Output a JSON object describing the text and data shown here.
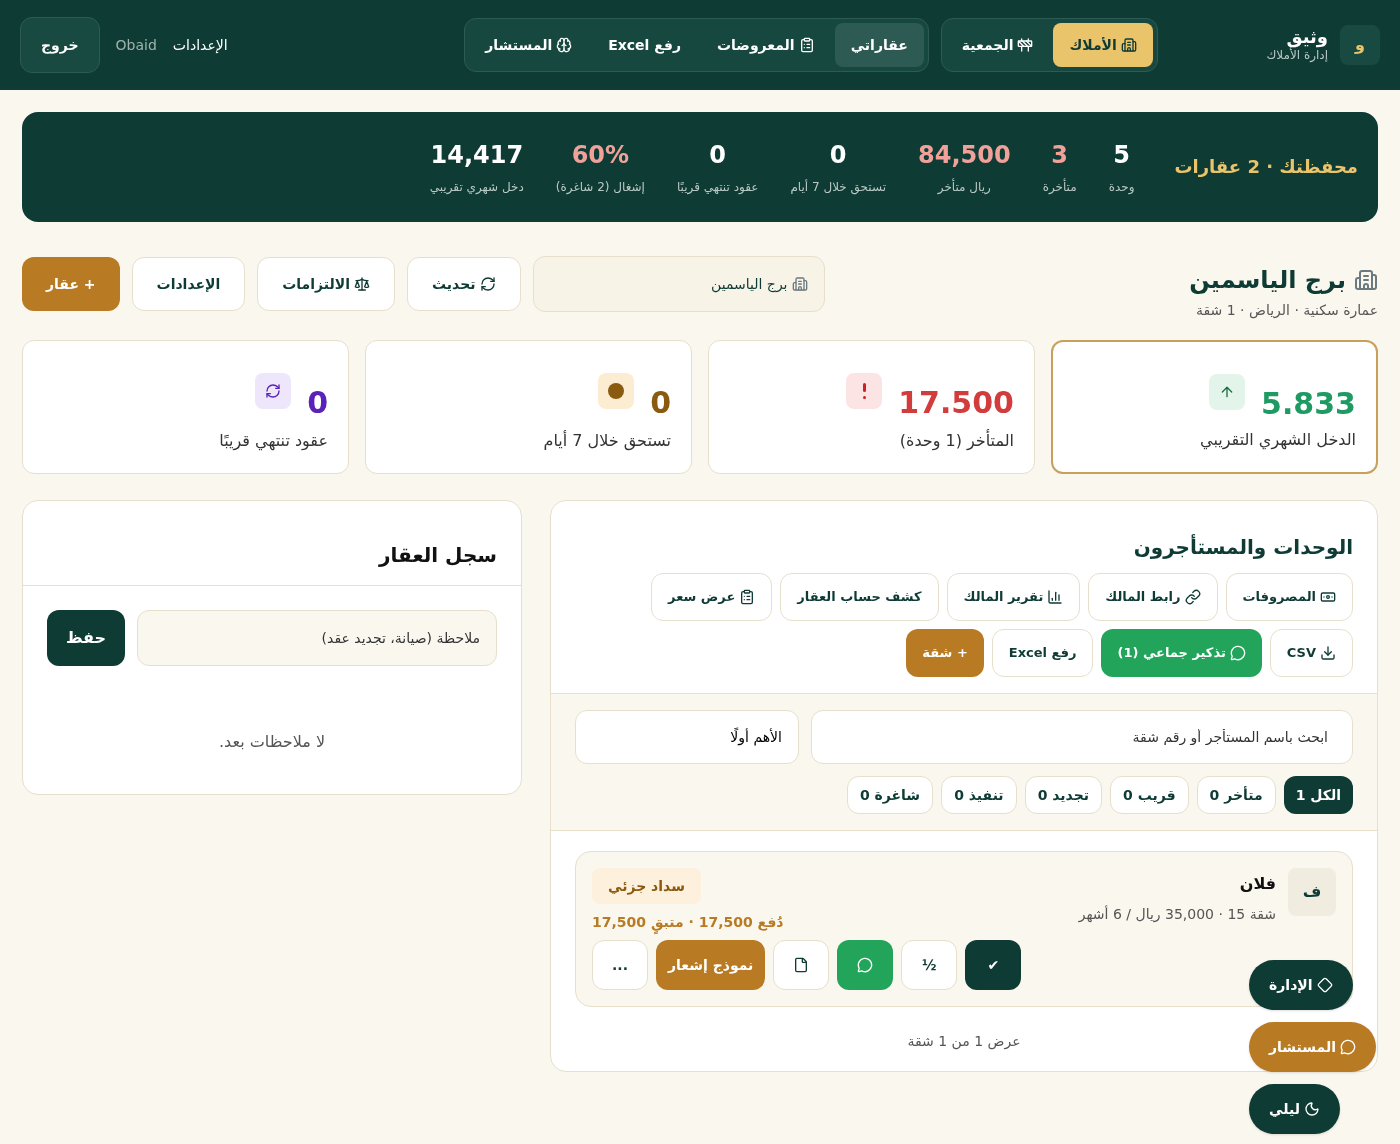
{
  "header": {
    "logo": "و",
    "brand": "وثيق",
    "subtitle": "إدارة الأملاك",
    "modes": [
      {
        "label": "الأملاك",
        "selected": true
      },
      {
        "label": "الجمعية",
        "selected": false
      }
    ],
    "nav": [
      {
        "label": "عقاراتي",
        "selected": true
      },
      {
        "label": "المعروضات",
        "selected": false
      },
      {
        "label": "رفع Excel",
        "selected": false
      },
      {
        "label": "المستشار",
        "selected": false
      }
    ],
    "settings": "الإعدادات",
    "user": "Obaid",
    "logout": "خروج"
  },
  "summary": {
    "title": "محفظتك · 2 عقارات",
    "stats": [
      {
        "value": "5",
        "label": "وحدة",
        "kind": "plain"
      },
      {
        "value": "3",
        "label": "متأخرة",
        "kind": "alert"
      },
      {
        "value": "84,500",
        "label": "ريال متأخر",
        "kind": "alert"
      },
      {
        "value": "0",
        "label": "تستحق خلال 7 أيام",
        "kind": "plain"
      },
      {
        "value": "0",
        "label": "عقود تنتهي قريبًا",
        "kind": "plain"
      },
      {
        "value": "60%",
        "label": "إشغال (2 شاغرة)",
        "kind": "alert"
      },
      {
        "value": "14,417",
        "label": "دخل شهري تقريبي",
        "kind": "plain"
      }
    ]
  },
  "property": {
    "title": "برج الياسمين",
    "subtitle": "عمارة سكنية · الرياض · 1 شقة",
    "selector": "برج الياسمين",
    "actions": [
      {
        "label": "تحديث",
        "kind": "outline"
      },
      {
        "label": "الالتزامات",
        "kind": "outline"
      },
      {
        "label": "الإعدادات",
        "kind": "outline"
      },
      {
        "label": "+ عقار",
        "kind": "primary"
      }
    ]
  },
  "kpis": [
    {
      "label": "الدخل الشهري التقريبي",
      "value": "5.833",
      "kind": "income",
      "selected": true
    },
    {
      "label": "المتأخر (1 وحدة)",
      "value": "17.500",
      "kind": "overdue",
      "selected": false
    },
    {
      "label": "تستحق خلال 7 أيام",
      "value": "0",
      "kind": "due",
      "selected": false
    },
    {
      "label": "عقود تنتهي قريبًا",
      "value": "0",
      "kind": "expiring",
      "selected": false
    }
  ],
  "units": {
    "title": "الوحدات والمستأجرون",
    "tools": [
      {
        "label": "المصروفات",
        "kind": "outline"
      },
      {
        "label": "رابط المالك",
        "kind": "outline"
      },
      {
        "label": "تقرير المالك",
        "kind": "outline"
      },
      {
        "label": "كشف حساب العقار",
        "kind": "outline"
      },
      {
        "label": "عرض سعر",
        "kind": "outline"
      },
      {
        "label": "CSV",
        "kind": "outline"
      },
      {
        "label": "تذكير جماعي (1)",
        "kind": "green"
      },
      {
        "label": "رفع Excel",
        "kind": "outline"
      },
      {
        "label": "+ شقة",
        "kind": "primary"
      }
    ],
    "search": {
      "placeholder": "ابحث باسم المستأجر أو رقم شقة"
    },
    "sort": "الأهم أولًا",
    "filters": [
      {
        "label": "الكل 1",
        "selected": true
      },
      {
        "label": "متأخر 0",
        "selected": false
      },
      {
        "label": "قريب 0",
        "selected": false
      },
      {
        "label": "تجديد 0",
        "selected": false
      },
      {
        "label": "تنفيذ 0",
        "selected": false
      },
      {
        "label": "شاغرة 0",
        "selected": false
      }
    ],
    "unit": {
      "initial": "ف",
      "name": "فلان",
      "details": "شقة 15 · 35,000 ريال / 6 أشهر",
      "status": "سداد جزئي",
      "payment": "دُفع 17,500 · متبقٍ 17,500",
      "buttons": [
        {
          "label": "✔",
          "kind": "dark"
        },
        {
          "label": "½",
          "kind": "outline"
        },
        {
          "kind": "green"
        },
        {
          "kind": "outline"
        },
        {
          "label": "نموذج إشعار",
          "kind": "primary"
        },
        {
          "label": "...",
          "kind": "outline"
        }
      ]
    },
    "footer": "عرض 1 من 1 شقة"
  },
  "notes": {
    "title": "سجل العقار",
    "placeholder": "ملاحظة (صيانة، تجديد عقد)",
    "save": "حفظ",
    "empty": "لا ملاحظات بعد."
  },
  "floating": [
    {
      "label": "الإدارة",
      "kind": "dark"
    },
    {
      "label": "المستشار",
      "kind": "primary"
    },
    {
      "label": "ليلي",
      "kind": "dark"
    }
  ]
}
